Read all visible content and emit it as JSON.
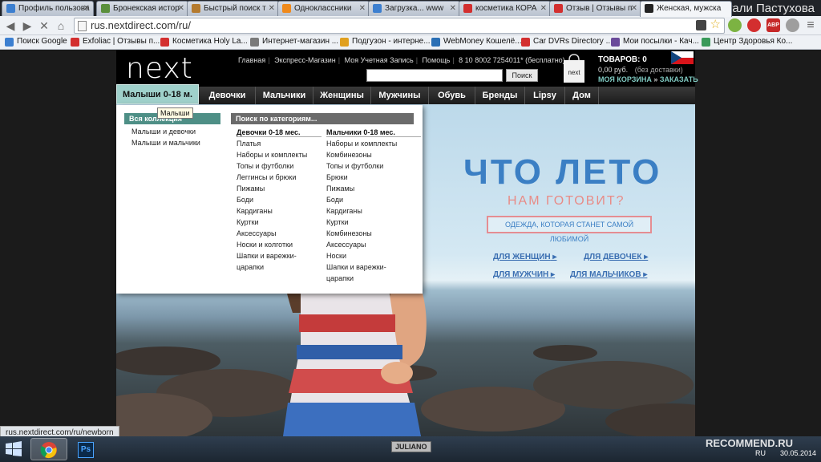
{
  "browser": {
    "tabs": [
      {
        "title": "Профиль пользова",
        "fav_color": "#3c7fd0"
      },
      {
        "title": "Бронекская истор",
        "fav_color": "#5a8f3c"
      },
      {
        "title": "Быстрый поиск т",
        "fav_color": "#b47a2e"
      },
      {
        "title": "Одноклассники",
        "fav_color": "#f08a1c"
      },
      {
        "title": "Загрузка... www",
        "fav_color": "#3c7fd0"
      },
      {
        "title": "косметика КОРА",
        "fav_color": "#d32f2f"
      },
      {
        "title": "Отзыв | Отзывы п",
        "fav_color": "#d32f2f"
      },
      {
        "title": "Женская, мужска",
        "fav_color": "#222222"
      }
    ],
    "profile_name": "Натали Пастухова",
    "url": "rus.nextdirect.com/ru/",
    "bookmarks": [
      {
        "label": "Поиск Google",
        "fav_color": "#3c7fd0"
      },
      {
        "label": "Exfoliac | Отзывы п...",
        "fav_color": "#d32f2f"
      },
      {
        "label": "Косметика Holy La...",
        "fav_color": "#d32f2f"
      },
      {
        "label": "Интернет-магазин ...",
        "fav_color": "#7a7a7a"
      },
      {
        "label": "Подгузон - интерне...",
        "fav_color": "#e0a020"
      },
      {
        "label": "WebMoney Кошелё...",
        "fav_color": "#2a6fb5"
      },
      {
        "label": "Car DVRs Directory ...",
        "fav_color": "#d32f2f"
      },
      {
        "label": "Мои посылки - Кач...",
        "fav_color": "#6a4a9a"
      },
      {
        "label": "Центр Здоровья Ко...",
        "fav_color": "#3a9a5a"
      }
    ]
  },
  "site": {
    "logo": "next",
    "top_links": [
      "Главная",
      "Экспресс-Магазин",
      "Моя Учетная Запись",
      "Помощь",
      "8 10 8002 7254011* (бесплатно)"
    ],
    "search_button": "Поиск",
    "bag_label": "next",
    "cart_count": "ТОВАРОВ: 0",
    "cart_sum": "0,00 руб.",
    "cart_sum_note": "(без доставки)",
    "cart_link": "МОЯ КОРЗИНА",
    "order_link": "ЗАКАЗАТЬ",
    "nav": [
      "Малыши 0-18 м.",
      "Девочки",
      "Мальчики",
      "Женщины",
      "Мужчины",
      "Обувь",
      "Бренды",
      "Lipsy",
      "Дом"
    ],
    "tooltip": "Малыши"
  },
  "dropdown": {
    "collections_header": "Вся коллекция",
    "collections": [
      "Малыши и девочки",
      "Малыши и мальчики"
    ],
    "category_header": "Поиск по категориям...",
    "girls_title": "Девочки 0-18 мес.",
    "girls": [
      "Платья",
      "Наборы и комплекты",
      "Топы и футболки",
      "Леггинсы и брюки",
      "Пижамы",
      "Боди",
      "Кардиганы",
      "Куртки",
      "Аксессуары",
      "Носки и колготки",
      "Шапки и варежки-",
      "царапки"
    ],
    "boys_title": "Мальчики 0-18 мес.",
    "boys": [
      "Наборы и комплекты",
      "Комбинезоны",
      "Топы и футболки",
      "Брюки",
      "Пижамы",
      "Боди",
      "Кардиганы",
      "Куртки",
      "Комбинезоны",
      "Аксессуары",
      "Носки",
      "Шапки и варежки-",
      "царапки"
    ]
  },
  "hero": {
    "title": "ЧТО ЛЕТО",
    "subtitle": "НАМ ГОТОВИТ?",
    "box_text": "ОДЕЖДА, КОТОРАЯ СТАНЕТ САМОЙ ЛЮБИМОЙ",
    "links": [
      "ДЛЯ ЖЕНЩИН",
      "ДЛЯ ДЕВОЧЕК",
      "ДЛЯ МУЖЧИН",
      "ДЛЯ МАЛЬЧИКОВ"
    ]
  },
  "status_url": "rus.nextdirect.com/ru/newborn",
  "taskbar": {
    "lang": "RU",
    "date": "30.05.2014",
    "brand_badge": "JULIANO"
  },
  "watermark": "RECOMMEND.RU"
}
